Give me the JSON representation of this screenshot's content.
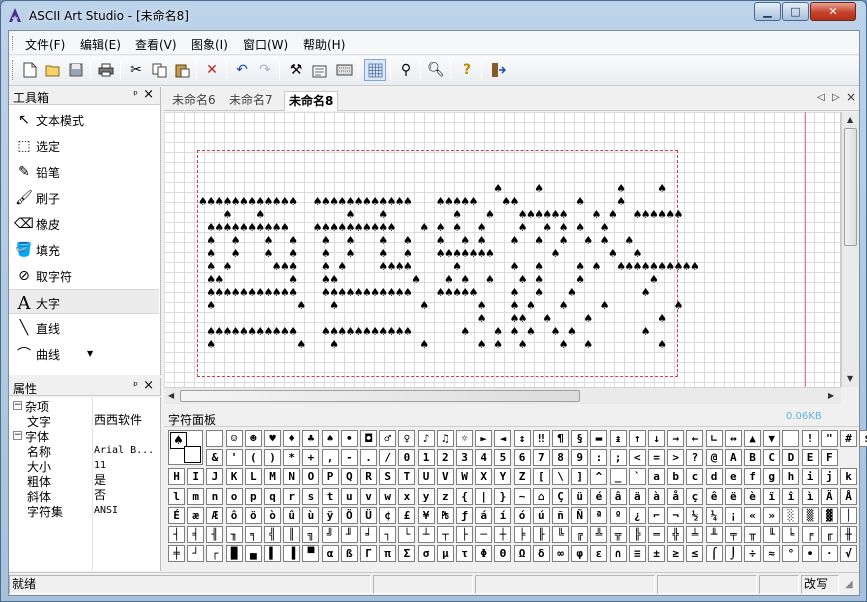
{
  "window": {
    "title": "ASCII Art Studio - [未命名8]"
  },
  "menu": [
    "文件(F)",
    "编辑(E)",
    "查看(V)",
    "图象(I)",
    "窗口(W)",
    "帮助(H)"
  ],
  "toolbar": {
    "icons": [
      "new-icon",
      "open-icon",
      "save-icon",
      "print-icon",
      "cut-icon",
      "copy-icon",
      "paste-icon",
      "delete-icon",
      "undo-icon",
      "redo-icon",
      "tools-icon",
      "properties-icon",
      "keyboard-icon",
      "grid-icon",
      "picker-icon",
      "search-icon",
      "help-icon",
      "exit-icon"
    ]
  },
  "toolbox": {
    "title": "工具箱",
    "pin": "ᵖ",
    "close": "×",
    "tools": [
      {
        "label": "文本模式",
        "icon": "cursor-icon",
        "glyph": "↖"
      },
      {
        "label": "选定",
        "icon": "select-rect-icon",
        "glyph": "⬚"
      },
      {
        "label": "铅笔",
        "icon": "pencil-icon",
        "glyph": "✎"
      },
      {
        "label": "刷子",
        "icon": "brush-icon",
        "glyph": "🖌"
      },
      {
        "label": "橡皮",
        "icon": "eraser-icon",
        "glyph": "⌫"
      },
      {
        "label": "填充",
        "icon": "fill-icon",
        "glyph": "🪣"
      },
      {
        "label": "取字符",
        "icon": "eyedropper-icon",
        "glyph": "⊘"
      },
      {
        "label": "大字",
        "icon": "big-text-icon",
        "glyph": "A"
      },
      {
        "label": "直线",
        "icon": "line-icon",
        "glyph": "╲"
      },
      {
        "label": "曲线",
        "icon": "curve-icon",
        "glyph": "⌒"
      }
    ],
    "selected_index": 7
  },
  "properties": {
    "title": "属性",
    "rows": [
      {
        "type": "cat",
        "sign": "⊟",
        "key": "杂项"
      },
      {
        "type": "prop",
        "key": "文字",
        "value": "西西软件",
        "cjk": true
      },
      {
        "type": "cat",
        "sign": "⊟",
        "key": "字体"
      },
      {
        "type": "prop",
        "key": "名称",
        "value": "Arial B..."
      },
      {
        "type": "prop",
        "key": "大小",
        "value": "11"
      },
      {
        "type": "prop",
        "key": "粗体",
        "value": "是",
        "cjk": true
      },
      {
        "type": "prop",
        "key": "斜体",
        "value": "否",
        "cjk": true
      },
      {
        "type": "prop",
        "key": "字符集",
        "value": "ANSI"
      }
    ]
  },
  "tabs": {
    "items": [
      "未命名6",
      "未命名7",
      "未命名8"
    ],
    "active": 2,
    "nav": [
      "◁",
      "▷",
      "×"
    ]
  },
  "art": {
    "glyph": "♠",
    "rows": [
      "                                    ♠    ♠         ♠    ♠",
      "♠♠♠♠♠♠♠♠♠♠♠♠  ♠♠♠♠♠♠♠♠♠♠♠♠   ♠♠♠♠♠   ♠♠       ♠    ♠",
      "   ♠   ♠          ♠   ♠        ♠   ♠   ♠♠♠♠♠♠   ♠ ♠  ♠♠♠♠♠♠",
      " ♠♠♠♠♠♠♠♠♠♠   ♠♠♠♠♠♠♠♠♠♠   ♠ ♠ ♠  ♠    ♠  ♠ ♠ ♠  ♠",
      " ♠  ♠   ♠  ♠   ♠  ♠   ♠  ♠   ♠  ♠ ♠   ♠  ♠  ♠  ♠ ♠  ♠",
      " ♠  ♠   ♠  ♠   ♠  ♠   ♠  ♠   ♠♠♠♠♠♠♠       ♠      ♠  ♠",
      " ♠ ♠     ♠♠♠   ♠ ♠    ♠♠♠♠     ♠      ♠  ♠    ♠ ♠  ♠♠♠♠♠♠♠♠♠♠",
      " ♠♠        ♠   ♠♠         ♠   ♠ ♠  ♠   ♠ ♠    ♠        ♠",
      " ♠♠♠♠♠♠♠♠♠♠♠   ♠♠♠♠♠♠♠♠♠♠♠   ♠♠♠♠♠    ♠  ♠   ♠        ♠",
      " ♠          ♠   ♠          ♠      ♠   ♠ ♠   ♠    ♠        ♠",
      "                                  ♠   ♠♠  ♠    ♠        ♠",
      " ♠♠♠♠♠♠♠♠♠♠♠   ♠♠♠♠♠♠♠♠♠♠♠      ♠   ♠ ♠ ♠  ♠ ♠        ♠",
      " ♠          ♠   ♠          ♠      ♠ ♠  ♠    ♠  ♠        ♠"
    ]
  },
  "charpanel": {
    "title": "字符面板",
    "pin": "ᵖ",
    "close": "×",
    "current_char": "♠",
    "rows": [
      [
        "",
        "☺",
        "☻",
        "♥",
        "♦",
        "♣",
        "♠",
        "•",
        "◘",
        "♂",
        "♀",
        "♪",
        "♫",
        "☼",
        "►",
        "◄",
        "↕",
        "‼",
        "¶",
        "§",
        "▬",
        "↨",
        "↑",
        "↓",
        "→",
        "←",
        "∟",
        "↔",
        "▲",
        "▼",
        " ",
        "!",
        "\"",
        "#",
        "$",
        "%"
      ],
      [
        "&",
        "'",
        "(",
        ")",
        "*",
        "+",
        ",",
        "-",
        ".",
        "/",
        "0",
        "1",
        "2",
        "3",
        "4",
        "5",
        "6",
        "7",
        "8",
        "9",
        ":",
        ";",
        "<",
        "=",
        ">",
        "?",
        "@",
        "A",
        "B",
        "C",
        "D",
        "E",
        "F"
      ],
      [
        "H",
        "I",
        "J",
        "K",
        "L",
        "M",
        "N",
        "O",
        "P",
        "Q",
        "R",
        "S",
        "T",
        "U",
        "V",
        "W",
        "X",
        "Y",
        "Z",
        "[",
        "\\",
        "]",
        "^",
        "_",
        "`",
        "a",
        "b",
        "c",
        "d",
        "e",
        "f",
        "g",
        "h",
        "i",
        "j",
        "k"
      ],
      [
        "l",
        "m",
        "n",
        "o",
        "p",
        "q",
        "r",
        "s",
        "t",
        "u",
        "v",
        "w",
        "x",
        "y",
        "z",
        "{",
        "|",
        "}",
        "~",
        "⌂",
        "Ç",
        "ü",
        "é",
        "â",
        "ä",
        "à",
        "å",
        "ç",
        "ê",
        "ë",
        "è",
        "ï",
        "î",
        "ì",
        "Ä",
        "Å"
      ],
      [
        "É",
        "æ",
        "Æ",
        "ô",
        "ö",
        "ò",
        "û",
        "ù",
        "ÿ",
        "Ö",
        "Ü",
        "¢",
        "£",
        "¥",
        "₧",
        "ƒ",
        "á",
        "í",
        "ó",
        "ú",
        "ñ",
        "Ñ",
        "ª",
        "º",
        "¿",
        "⌐",
        "¬",
        "½",
        "¼",
        "¡",
        "«",
        "»",
        "░",
        "▒",
        "▓",
        "│"
      ],
      [
        "┤",
        "╡",
        "╢",
        "╖",
        "╕",
        "╣",
        "║",
        "╗",
        "╝",
        "╜",
        "╛",
        "┐",
        "└",
        "┴",
        "┬",
        "├",
        "─",
        "┼",
        "╞",
        "╟",
        "╚",
        "╔",
        "╩",
        "╦",
        "╠",
        "═",
        "╬",
        "╧",
        "╨",
        "╤",
        "╥",
        "╙",
        "╘",
        "╒",
        "╓",
        "╫"
      ],
      [
        "╪",
        "┘",
        "┌",
        "█",
        "▄",
        "▌",
        "▐",
        "▀",
        "α",
        "ß",
        "Γ",
        "π",
        "Σ",
        "σ",
        "µ",
        "τ",
        "Φ",
        "Θ",
        "Ω",
        "δ",
        "∞",
        "φ",
        "ε",
        "∩",
        "≡",
        "±",
        "≥",
        "≤",
        "⌠",
        "⌡",
        "÷",
        "≈",
        "°",
        "∙",
        "·",
        "√"
      ]
    ]
  },
  "status": {
    "ready": "就绪",
    "mode": "改写"
  },
  "watermark": "0.06KB"
}
